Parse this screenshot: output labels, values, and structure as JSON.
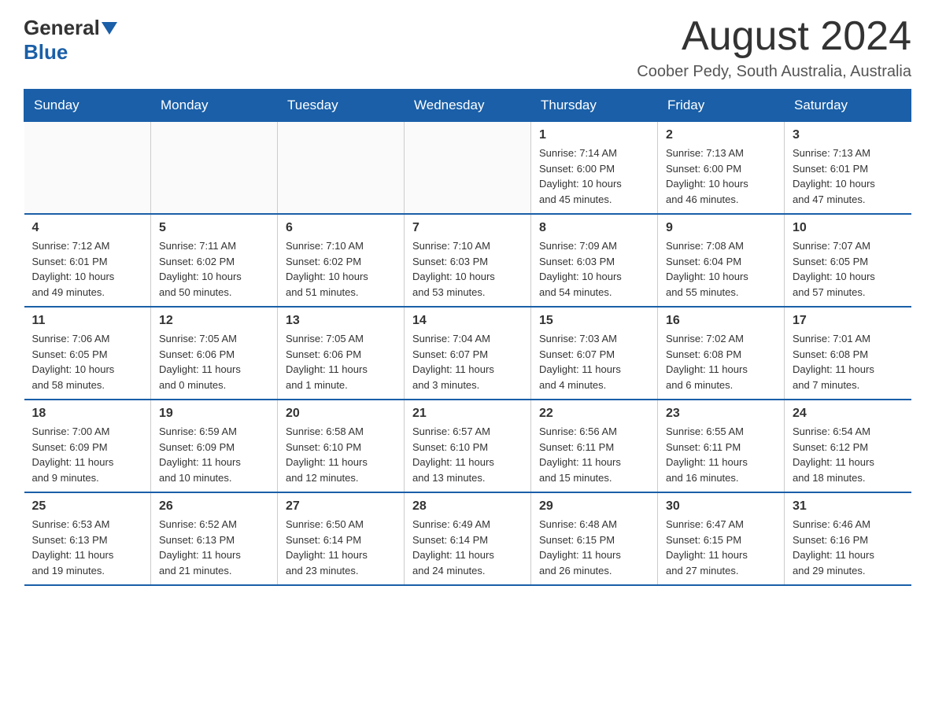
{
  "logo": {
    "text_general": "General",
    "text_blue": "Blue"
  },
  "header": {
    "month_title": "August 2024",
    "location": "Coober Pedy, South Australia, Australia"
  },
  "days_of_week": [
    "Sunday",
    "Monday",
    "Tuesday",
    "Wednesday",
    "Thursday",
    "Friday",
    "Saturday"
  ],
  "weeks": [
    [
      {
        "day": "",
        "info": ""
      },
      {
        "day": "",
        "info": ""
      },
      {
        "day": "",
        "info": ""
      },
      {
        "day": "",
        "info": ""
      },
      {
        "day": "1",
        "info": "Sunrise: 7:14 AM\nSunset: 6:00 PM\nDaylight: 10 hours\nand 45 minutes."
      },
      {
        "day": "2",
        "info": "Sunrise: 7:13 AM\nSunset: 6:00 PM\nDaylight: 10 hours\nand 46 minutes."
      },
      {
        "day": "3",
        "info": "Sunrise: 7:13 AM\nSunset: 6:01 PM\nDaylight: 10 hours\nand 47 minutes."
      }
    ],
    [
      {
        "day": "4",
        "info": "Sunrise: 7:12 AM\nSunset: 6:01 PM\nDaylight: 10 hours\nand 49 minutes."
      },
      {
        "day": "5",
        "info": "Sunrise: 7:11 AM\nSunset: 6:02 PM\nDaylight: 10 hours\nand 50 minutes."
      },
      {
        "day": "6",
        "info": "Sunrise: 7:10 AM\nSunset: 6:02 PM\nDaylight: 10 hours\nand 51 minutes."
      },
      {
        "day": "7",
        "info": "Sunrise: 7:10 AM\nSunset: 6:03 PM\nDaylight: 10 hours\nand 53 minutes."
      },
      {
        "day": "8",
        "info": "Sunrise: 7:09 AM\nSunset: 6:03 PM\nDaylight: 10 hours\nand 54 minutes."
      },
      {
        "day": "9",
        "info": "Sunrise: 7:08 AM\nSunset: 6:04 PM\nDaylight: 10 hours\nand 55 minutes."
      },
      {
        "day": "10",
        "info": "Sunrise: 7:07 AM\nSunset: 6:05 PM\nDaylight: 10 hours\nand 57 minutes."
      }
    ],
    [
      {
        "day": "11",
        "info": "Sunrise: 7:06 AM\nSunset: 6:05 PM\nDaylight: 10 hours\nand 58 minutes."
      },
      {
        "day": "12",
        "info": "Sunrise: 7:05 AM\nSunset: 6:06 PM\nDaylight: 11 hours\nand 0 minutes."
      },
      {
        "day": "13",
        "info": "Sunrise: 7:05 AM\nSunset: 6:06 PM\nDaylight: 11 hours\nand 1 minute."
      },
      {
        "day": "14",
        "info": "Sunrise: 7:04 AM\nSunset: 6:07 PM\nDaylight: 11 hours\nand 3 minutes."
      },
      {
        "day": "15",
        "info": "Sunrise: 7:03 AM\nSunset: 6:07 PM\nDaylight: 11 hours\nand 4 minutes."
      },
      {
        "day": "16",
        "info": "Sunrise: 7:02 AM\nSunset: 6:08 PM\nDaylight: 11 hours\nand 6 minutes."
      },
      {
        "day": "17",
        "info": "Sunrise: 7:01 AM\nSunset: 6:08 PM\nDaylight: 11 hours\nand 7 minutes."
      }
    ],
    [
      {
        "day": "18",
        "info": "Sunrise: 7:00 AM\nSunset: 6:09 PM\nDaylight: 11 hours\nand 9 minutes."
      },
      {
        "day": "19",
        "info": "Sunrise: 6:59 AM\nSunset: 6:09 PM\nDaylight: 11 hours\nand 10 minutes."
      },
      {
        "day": "20",
        "info": "Sunrise: 6:58 AM\nSunset: 6:10 PM\nDaylight: 11 hours\nand 12 minutes."
      },
      {
        "day": "21",
        "info": "Sunrise: 6:57 AM\nSunset: 6:10 PM\nDaylight: 11 hours\nand 13 minutes."
      },
      {
        "day": "22",
        "info": "Sunrise: 6:56 AM\nSunset: 6:11 PM\nDaylight: 11 hours\nand 15 minutes."
      },
      {
        "day": "23",
        "info": "Sunrise: 6:55 AM\nSunset: 6:11 PM\nDaylight: 11 hours\nand 16 minutes."
      },
      {
        "day": "24",
        "info": "Sunrise: 6:54 AM\nSunset: 6:12 PM\nDaylight: 11 hours\nand 18 minutes."
      }
    ],
    [
      {
        "day": "25",
        "info": "Sunrise: 6:53 AM\nSunset: 6:13 PM\nDaylight: 11 hours\nand 19 minutes."
      },
      {
        "day": "26",
        "info": "Sunrise: 6:52 AM\nSunset: 6:13 PM\nDaylight: 11 hours\nand 21 minutes."
      },
      {
        "day": "27",
        "info": "Sunrise: 6:50 AM\nSunset: 6:14 PM\nDaylight: 11 hours\nand 23 minutes."
      },
      {
        "day": "28",
        "info": "Sunrise: 6:49 AM\nSunset: 6:14 PM\nDaylight: 11 hours\nand 24 minutes."
      },
      {
        "day": "29",
        "info": "Sunrise: 6:48 AM\nSunset: 6:15 PM\nDaylight: 11 hours\nand 26 minutes."
      },
      {
        "day": "30",
        "info": "Sunrise: 6:47 AM\nSunset: 6:15 PM\nDaylight: 11 hours\nand 27 minutes."
      },
      {
        "day": "31",
        "info": "Sunrise: 6:46 AM\nSunset: 6:16 PM\nDaylight: 11 hours\nand 29 minutes."
      }
    ]
  ]
}
